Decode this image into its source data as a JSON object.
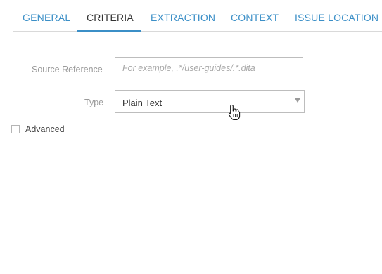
{
  "tabs": [
    {
      "label": "GENERAL",
      "active": false
    },
    {
      "label": "CRITERIA",
      "active": true
    },
    {
      "label": "EXTRACTION",
      "active": false
    },
    {
      "label": "CONTEXT",
      "active": false
    },
    {
      "label": "ISSUE LOCATION",
      "active": false
    }
  ],
  "form": {
    "source_reference": {
      "label": "Source Reference",
      "value": "",
      "placeholder": "For example, .*/user-guides/.*.dita"
    },
    "type": {
      "label": "Type",
      "selected": "Plain Text",
      "caret_icon": "triangle-down-icon"
    },
    "advanced": {
      "label": "Advanced",
      "checked": false
    }
  },
  "colors": {
    "accent": "#3b8fc7",
    "active_tab_text": "#333333",
    "label_text": "#9a9a9a",
    "border": "#bdbdbd"
  },
  "cursor_icon": "hand-pointer-icon"
}
